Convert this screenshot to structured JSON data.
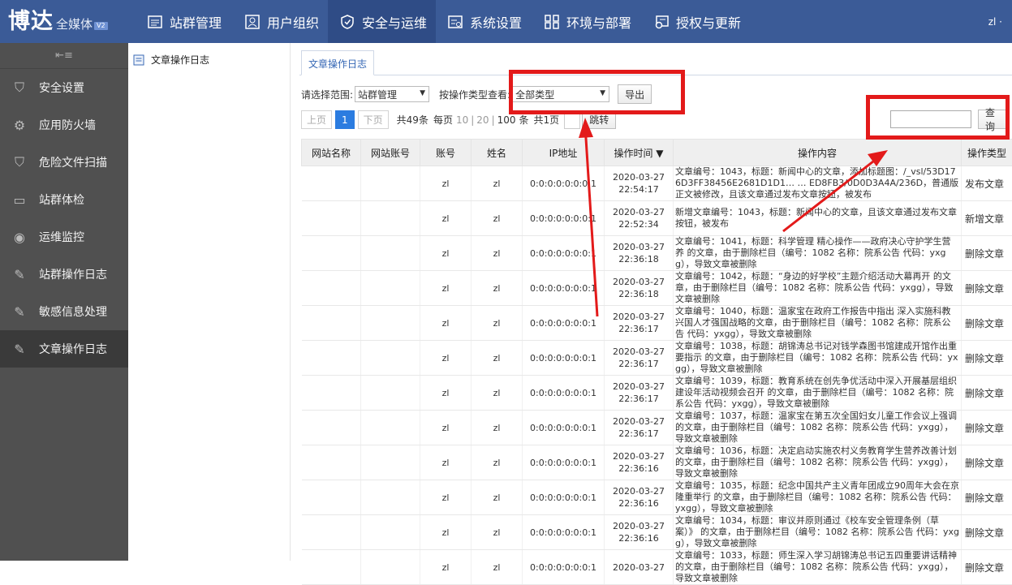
{
  "header": {
    "logo_main": "博达",
    "logo_sub": "全媒体",
    "logo_version": "V2",
    "nav": [
      {
        "label": "站群管理",
        "icon": "site-group-icon"
      },
      {
        "label": "用户组织",
        "icon": "user-org-icon"
      },
      {
        "label": "安全与运维",
        "icon": "shield-icon"
      },
      {
        "label": "系统设置",
        "icon": "settings-icon"
      },
      {
        "label": "环境与部署",
        "icon": "deploy-icon"
      },
      {
        "label": "授权与更新",
        "icon": "license-icon"
      }
    ],
    "user": "zl ·"
  },
  "sidebar": {
    "items": [
      {
        "label": "安全设置",
        "icon": "shield-icon"
      },
      {
        "label": "应用防火墙",
        "icon": "firewall-icon"
      },
      {
        "label": "危险文件扫描",
        "icon": "scan-icon"
      },
      {
        "label": "站群体检",
        "icon": "pulse-icon"
      },
      {
        "label": "运维监控",
        "icon": "eye-icon"
      },
      {
        "label": "站群操作日志",
        "icon": "edit-icon"
      },
      {
        "label": "敏感信息处理",
        "icon": "edit-icon"
      },
      {
        "label": "文章操作日志",
        "icon": "edit-icon"
      }
    ]
  },
  "tree": {
    "node_label": "文章操作日志"
  },
  "main": {
    "tab_label": "文章操作日志",
    "scope_label": "请选择范围:",
    "scope_value": "站群管理",
    "type_label": "按操作类型查看:",
    "type_value": "全部类型",
    "export_label": "导出",
    "pager": {
      "prev": "上页",
      "current": "1",
      "next": "下页",
      "total": "共49条",
      "per_page_label": "每页",
      "size_options": [
        "10",
        "20",
        "100"
      ],
      "unit": "条",
      "pages": "共1页",
      "goto": "跳转"
    },
    "search_button": "查询",
    "columns": [
      "网站名称",
      "网站账号",
      "账号",
      "姓名",
      "IP地址",
      "操作时间 ▼",
      "操作内容",
      "操作类型"
    ],
    "rows": [
      {
        "site": "",
        "acct": "",
        "account": "zl",
        "name": "zl",
        "ip": "0:0:0:0:0:0:0:1",
        "date": "2020-03-27",
        "time": "22:54:17",
        "content": "文章编号：1043，标题：新闻中心的文章，添加标题图：/_vsl/53D176D3FF38456E2681D1D1… … ED8FB3/0D0D3A4A/236D，普通版正文被修改，且该文章通过发布文章按钮，被发布",
        "type": "发布文章"
      },
      {
        "site": "",
        "acct": "",
        "account": "zl",
        "name": "zl",
        "ip": "0:0:0:0:0:0:0:1",
        "date": "2020-03-27",
        "time": "22:52:34",
        "content": "新增文章编号：1043，标题：新闻中心的文章，且该文章通过发布文章按钮，被发布",
        "type": "新增文章"
      },
      {
        "site": "",
        "acct": "",
        "account": "zl",
        "name": "zl",
        "ip": "0:0:0:0:0:0:0:1",
        "date": "2020-03-27",
        "time": "22:36:18",
        "content": "文章编号：1041，标题：科学管理 精心操作——政府决心守护学生营养 的文章，由于删除栏目（编号：1082 名称：院系公告 代码：yxgg），导致文章被删除",
        "type": "删除文章"
      },
      {
        "site": "",
        "acct": "",
        "account": "zl",
        "name": "zl",
        "ip": "0:0:0:0:0:0:0:1",
        "date": "2020-03-27",
        "time": "22:36:18",
        "content": "文章编号：1042，标题：“身边的好学校”主题介绍活动大幕再开 的文章，由于删除栏目（编号：1082 名称：院系公告 代码：yxgg），导致文章被删除",
        "type": "删除文章"
      },
      {
        "site": "",
        "acct": "",
        "account": "zl",
        "name": "zl",
        "ip": "0:0:0:0:0:0:0:1",
        "date": "2020-03-27",
        "time": "22:36:17",
        "content": "文章编号：1040，标题：温家宝在政府工作报告中指出 深入实施科教兴国人才强国战略的文章，由于删除栏目（编号：1082 名称：院系公告 代码：yxgg），导致文章被删除",
        "type": "删除文章"
      },
      {
        "site": "",
        "acct": "",
        "account": "zl",
        "name": "zl",
        "ip": "0:0:0:0:0:0:0:1",
        "date": "2020-03-27",
        "time": "22:36:17",
        "content": "文章编号：1038，标题：胡锦涛总书记对钱学森图书馆建成开馆作出重要指示 的文章，由于删除栏目（编号：1082 名称：院系公告 代码：yxgg），导致文章被删除",
        "type": "删除文章"
      },
      {
        "site": "",
        "acct": "",
        "account": "zl",
        "name": "zl",
        "ip": "0:0:0:0:0:0:0:1",
        "date": "2020-03-27",
        "time": "22:36:17",
        "content": "文章编号：1039，标题：教育系统在创先争优活动中深入开展基层组织建设年活动视频会召开 的文章，由于删除栏目（编号：1082 名称：院系公告 代码：yxgg），导致文章被删除",
        "type": "删除文章"
      },
      {
        "site": "",
        "acct": "",
        "account": "zl",
        "name": "zl",
        "ip": "0:0:0:0:0:0:0:1",
        "date": "2020-03-27",
        "time": "22:36:17",
        "content": "文章编号：1037，标题：温家宝在第五次全国妇女儿童工作会议上强调 的文章，由于删除栏目（编号：1082 名称：院系公告 代码：yxgg），导致文章被删除",
        "type": "删除文章"
      },
      {
        "site": "",
        "acct": "",
        "account": "zl",
        "name": "zl",
        "ip": "0:0:0:0:0:0:0:1",
        "date": "2020-03-27",
        "time": "22:36:16",
        "content": "文章编号：1036，标题：决定启动实施农村义务教育学生营养改善计划 的文章，由于删除栏目（编号：1082 名称：院系公告 代码：yxgg），导致文章被删除",
        "type": "删除文章"
      },
      {
        "site": "",
        "acct": "",
        "account": "zl",
        "name": "zl",
        "ip": "0:0:0:0:0:0:0:1",
        "date": "2020-03-27",
        "time": "22:36:16",
        "content": "文章编号：1035，标题：纪念中国共产主义青年团成立90周年大会在京隆重举行 的文章，由于删除栏目（编号：1082 名称：院系公告 代码：yxgg），导致文章被删除",
        "type": "删除文章"
      },
      {
        "site": "",
        "acct": "",
        "account": "zl",
        "name": "zl",
        "ip": "0:0:0:0:0:0:0:1",
        "date": "2020-03-27",
        "time": "22:36:16",
        "content": "文章编号：1034，标题：审议并原则通过《校车安全管理条例（草案）》 的文章，由于删除栏目（编号：1082 名称：院系公告 代码：yxgg），导致文章被删除",
        "type": "删除文章"
      },
      {
        "site": "",
        "acct": "",
        "account": "zl",
        "name": "zl",
        "ip": "0:0:0:0:0:0:0:1",
        "date": "2020-03-27",
        "time": "",
        "content": "文章编号：1033，标题：师生深入学习胡锦涛总书记五四重要讲话精神的文章，由于删除栏目（编号：1082 名称：院系公告 代码：yxgg），导致文章被删除",
        "type": "删除文章"
      }
    ]
  },
  "colors": {
    "header_bg": "#3b5b97",
    "sidebar_bg": "#505050",
    "highlight": "#e31a1a",
    "pager_active": "#2b7ce0"
  }
}
